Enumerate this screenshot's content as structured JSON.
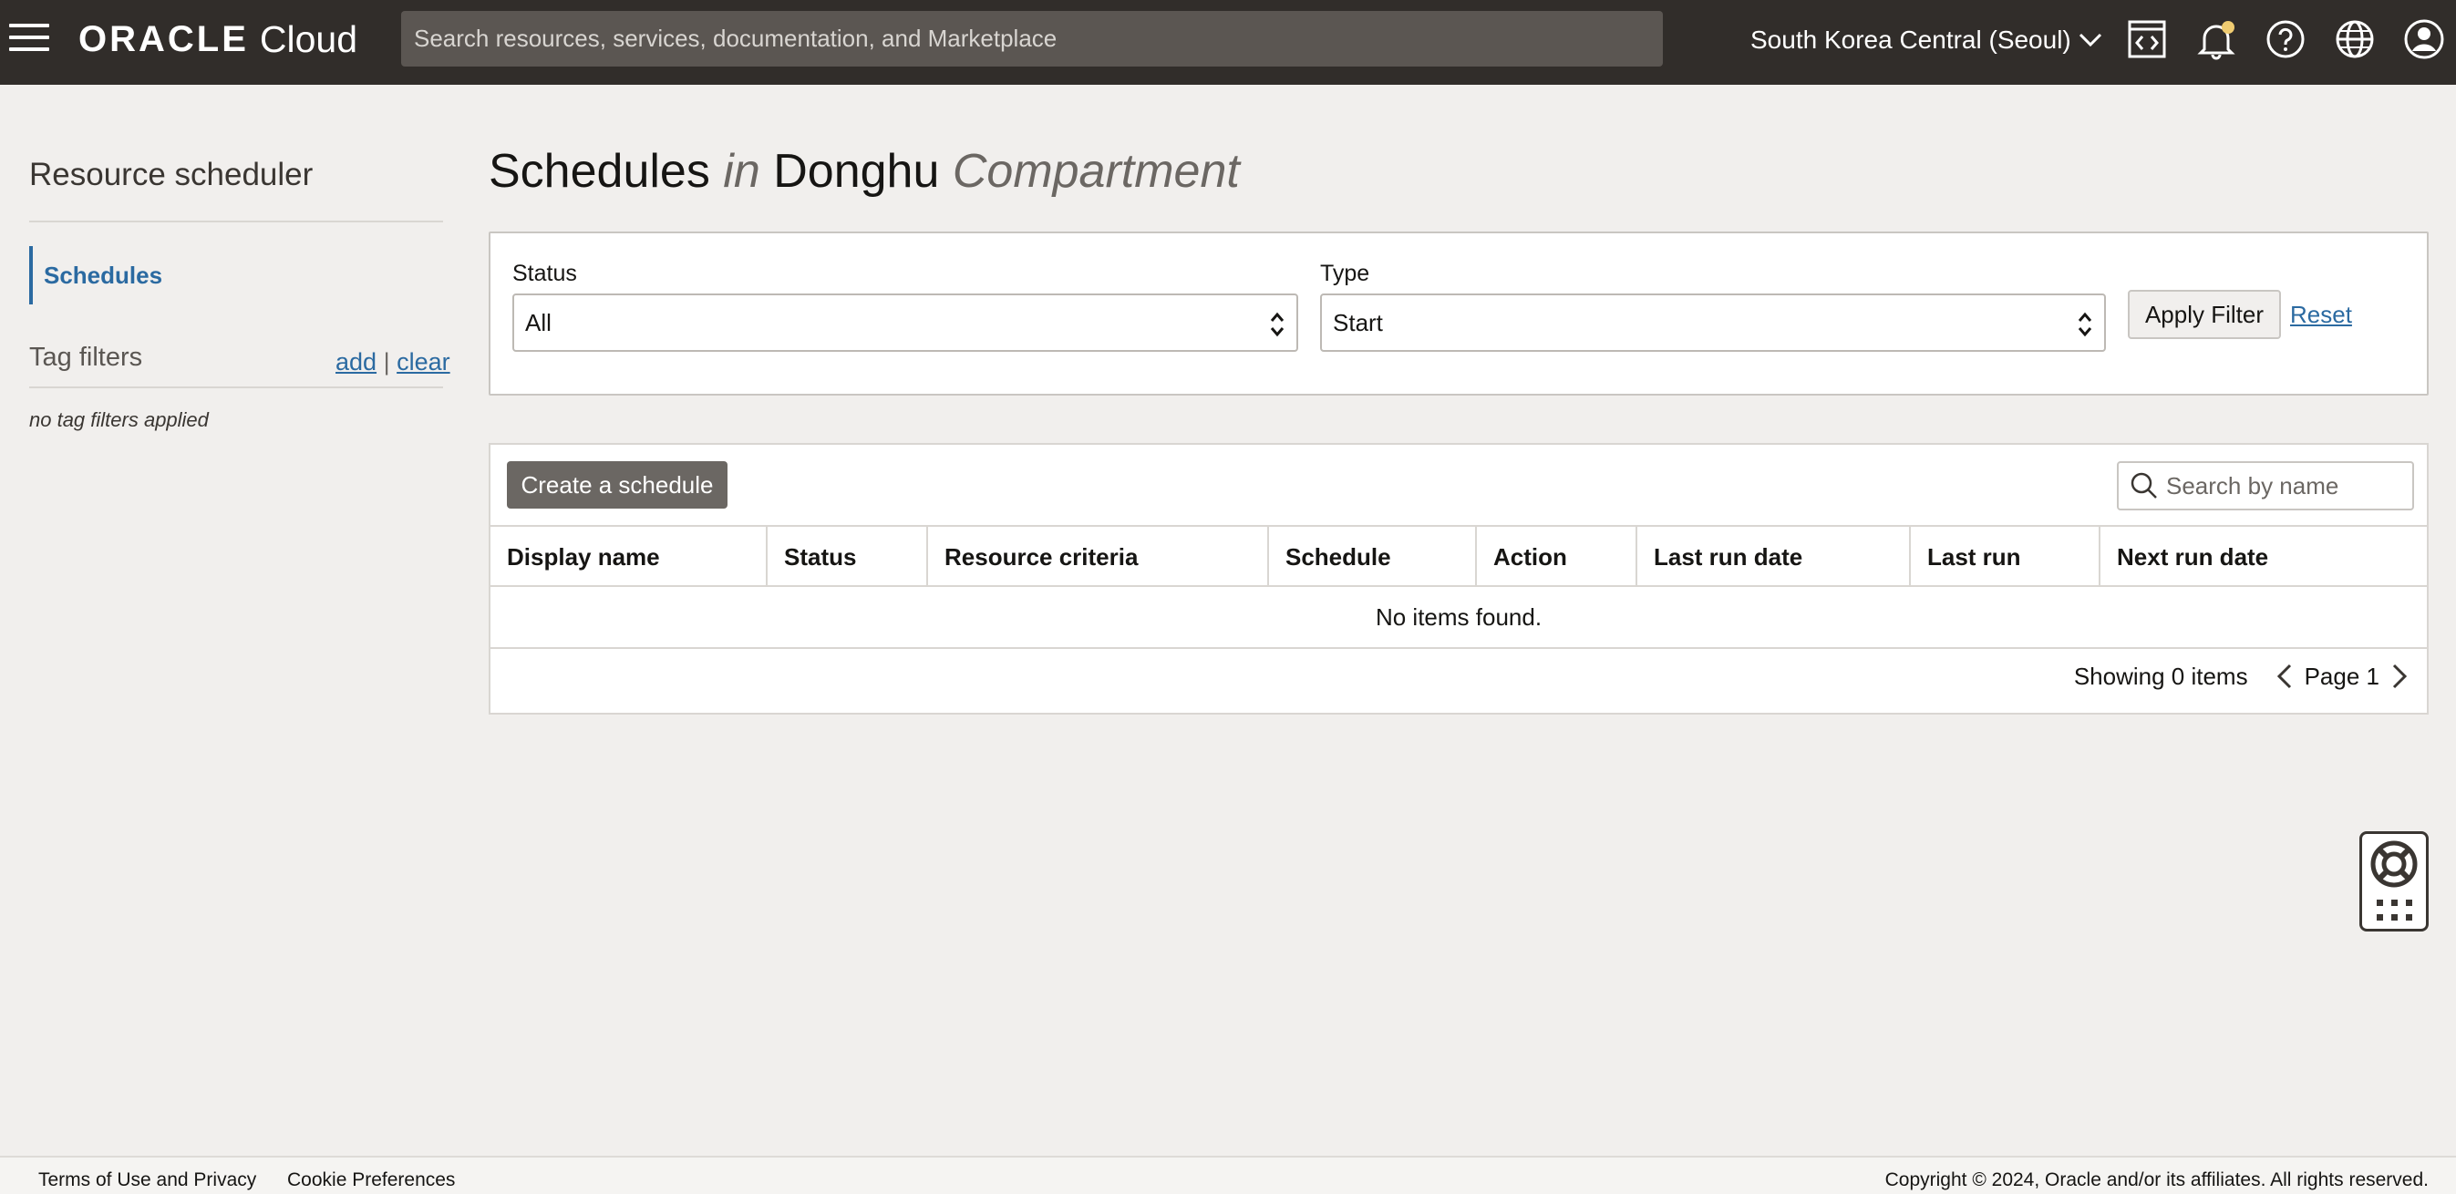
{
  "header": {
    "brand_oracle": "ORACLE",
    "brand_cloud": "Cloud",
    "search_placeholder": "Search resources, services, documentation, and Marketplace",
    "region": "South Korea Central (Seoul)",
    "icons": [
      "code-editor-icon",
      "notification-bell-icon",
      "help-icon",
      "language-globe-icon",
      "user-profile-icon"
    ]
  },
  "sidebar": {
    "title": "Resource scheduler",
    "items": [
      {
        "label": "Schedules",
        "active": true
      }
    ],
    "tag_filters": {
      "title": "Tag filters",
      "add": "add",
      "separator": "|",
      "clear": "clear",
      "empty": "no tag filters applied"
    }
  },
  "main": {
    "title": {
      "part1": "Schedules",
      "part2": "in",
      "part3": "Donghu",
      "part4": "Compartment"
    },
    "filters": {
      "status_label": "Status",
      "status_value": "All",
      "type_label": "Type",
      "type_value": "Start",
      "apply": "Apply Filter",
      "reset": "Reset"
    },
    "table": {
      "create_button": "Create a schedule",
      "search_placeholder": "Search by name",
      "columns": [
        "Display name",
        "Status",
        "Resource criteria",
        "Schedule",
        "Action",
        "Last run date",
        "Last run",
        "Next run date"
      ],
      "empty_message": "No items found.",
      "count": "Showing 0 items",
      "page": "Page 1"
    }
  },
  "footer": {
    "terms": "Terms of Use and Privacy",
    "cookies": "Cookie Preferences",
    "copyright": "Copyright © 2024, Oracle and/or its affiliates. All rights reserved."
  },
  "colors": {
    "header_bg": "#312d2a",
    "link": "#2b6aa1",
    "notification_dot": "#f0cc71"
  }
}
